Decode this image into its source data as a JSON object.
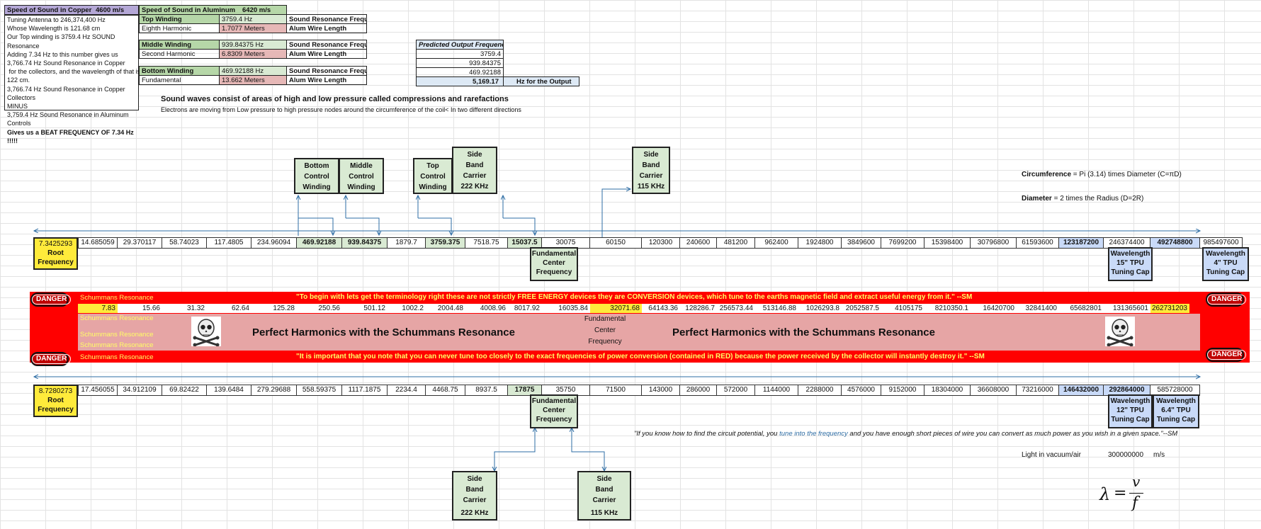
{
  "top_left": {
    "copper_label": "Speed of Sound in Copper",
    "copper_value": "4600 m/s",
    "aluminum_label": "Speed of Sound in Aluminum",
    "aluminum_value": "6420 m/s",
    "info_lines": [
      "Tuning Antenna to 246,374,400 Hz",
      "Whose Wavelength is 121.68 cm",
      "Our Top winding is 3759.4 Hz SOUND Resonance",
      "Adding 7.34 Hz to this number gives us",
      "3,766.74 Hz Sound Resonance in Copper",
      " for the collectors, and the wavelength of that is",
      "122 cm.",
      "3,766.74 Hz Sound Resonance in Copper Collectors",
      "MINUS",
      "3,759.4 Hz Sound Resonance in Aluminum Controls",
      "Gives us a BEAT FREQUENCY OF 7.34 Hz !!!!!"
    ]
  },
  "windings": {
    "top": {
      "name": "Top Winding",
      "freq": "3759.4 Hz",
      "freq_label": "Sound Resonance Frequency",
      "harmonic": "Eighth Harmonic",
      "length": "1.7077 Meters",
      "length_label": "Alum Wire Length"
    },
    "middle": {
      "name": "Middle Winding",
      "freq": "939.84375 Hz",
      "freq_label": "Sound Resonance Frequency",
      "harmonic": "Second Harmonic",
      "length": "6.8309 Meters",
      "length_label": "Alum Wire Length"
    },
    "bottom": {
      "name": "Bottom Winding",
      "freq": "469.92188 Hz",
      "freq_label": "Sound Resonance Frequency",
      "harmonic": "Fundamental",
      "length": "13.662 Meters",
      "length_label": "Alum Wire Length"
    }
  },
  "predicted": {
    "header": "Predicted Output Frequency",
    "values": [
      "3759.4",
      "939.84375",
      "469.92188"
    ],
    "total": "5,169.17",
    "total_label": "Hz for the Output"
  },
  "sound_waves_title": "Sound waves consist of areas of high and low pressure called compressions and rarefactions",
  "electrons_text": "Electrons are moving from Low pressure to high pressure nodes around the circumference of the coil< In two different directions",
  "control_boxes": {
    "bottom": [
      "Bottom",
      "Control",
      "Winding"
    ],
    "middle": [
      "Middle",
      "Control",
      "Winding"
    ],
    "top": [
      "Top",
      "Control",
      "Winding"
    ],
    "side_222_top": [
      "Side",
      "Band",
      "Carrier",
      "222 KHz"
    ],
    "side_115_top": [
      "Side",
      "Band",
      "Carrier",
      "115 KHz"
    ],
    "side_222_bottom": [
      "Side",
      "Band",
      "Carrier",
      "222 KHz"
    ],
    "side_115_bottom": [
      "Side",
      "Band",
      "Carrier",
      "115 KHz"
    ]
  },
  "formulas": {
    "circ_bold": "Circumference",
    "circ_rest": " = Pi (3.14) times Diameter (C=πD)",
    "diam_bold": "Diameter",
    "diam_rest": " = 2 times the Radius (D=2R)"
  },
  "row1": {
    "root_value": "7.3425293",
    "root_label": [
      "Root",
      "Frequency"
    ],
    "values": [
      "14.685059",
      "29.370117",
      "58.74023",
      "117.4805",
      "234.96094",
      "469.92188",
      "939.84375",
      "1879.7",
      "3759.375",
      "7518.75",
      "15037.5",
      "30075",
      "60150",
      "120300",
      "240600",
      "481200",
      "962400",
      "1924800",
      "3849600",
      "7699200",
      "15398400",
      "30796800",
      "61593600",
      "123187200",
      "246374400",
      "492748800",
      "985497600"
    ],
    "fund_label": [
      "Fundamental",
      "Center",
      "Frequency"
    ],
    "cap1_label": [
      "Wavelength",
      "15\" TPU",
      "Tuning Cap"
    ],
    "cap2_label": [
      "Wavelength",
      "4\" TPU",
      "Tuning Cap"
    ]
  },
  "schumann": {
    "label": "Schummans Resonance",
    "quote1": "\"To begin with lets get the terminology right these are not strictly FREE ENERGY devices they are CONVERSION devices, which tune to the earths magnetic field and extract useful energy from it.\" --SM",
    "quote2": "\"It is important that you note that you can never tune too closely to the exact frequencies of power conversion (contained in RED) because the power received by the collector will instantly destroy it.\" --SM",
    "values": [
      "7.83",
      "15.66",
      "31.32",
      "62.64",
      "125.28",
      "250.56",
      "501.12",
      "1002.2",
      "2004.48",
      "4008.96",
      "8017.92",
      "16035.84",
      "32071.68",
      "64143.36",
      "128286.7",
      "256573.44",
      "513146.88",
      "1026293.8",
      "2052587.5",
      "4105175",
      "8210350.1",
      "16420700",
      "32841400",
      "65682801",
      "131365601",
      "262731203"
    ],
    "fund_label": [
      "Fundamental",
      "Center",
      "Frequency"
    ],
    "perfect_text": "Perfect Harmonics with the Schummans Resonance",
    "danger": "DANGER"
  },
  "row2": {
    "root_value": "8.7280273",
    "root_label": [
      "Root",
      "Frequency"
    ],
    "values": [
      "17.456055",
      "34.912109",
      "69.82422",
      "139.6484",
      "279.29688",
      "558.59375",
      "1117.1875",
      "2234.4",
      "4468.75",
      "8937.5",
      "17875",
      "35750",
      "71500",
      "143000",
      "286000",
      "572000",
      "1144000",
      "2288000",
      "4576000",
      "9152000",
      "18304000",
      "36608000",
      "73216000",
      "146432000",
      "292864000",
      "585728000"
    ],
    "fund_label": [
      "Fundamental",
      "Center",
      "Frequency"
    ],
    "cap1_label": [
      "Wavelength",
      "12\" TPU",
      "Tuning Cap"
    ],
    "cap2_label": [
      "Wavelength",
      "6.4\" TPU",
      "Tuning Cap"
    ]
  },
  "quote_circuit": {
    "part1": "\"If you know how to find the circuit potential, you ",
    "link": "tune into the frequency",
    "part2": " and you have enough short pieces of wire you can convert as much power as you wish in a given space.\"--SM"
  },
  "light": {
    "label": "Light in vacuum/air",
    "value": "300000000",
    "unit": "m/s"
  },
  "equation": {
    "lambda": "λ",
    "eq": "=",
    "v": "v",
    "f": "f"
  },
  "colors": {
    "red": "#ff0000",
    "pink": "#e6a5a5",
    "yellow": "#ffeb3b",
    "green": "#d9ead3",
    "blue": "#c9daf8",
    "danger": "#c00000"
  }
}
